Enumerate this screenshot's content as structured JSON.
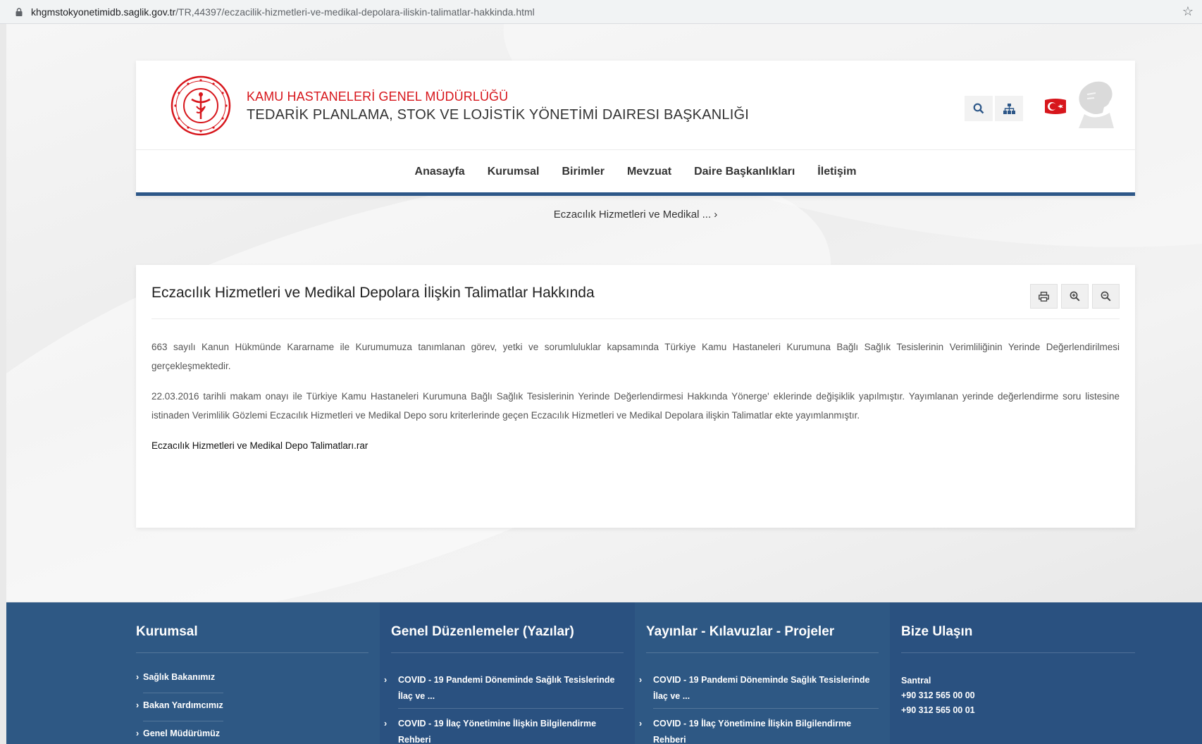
{
  "browser": {
    "url_host": "khgmstokyonetimidb.saglik.gov.tr",
    "url_path": "/TR,44397/eczacilik-hizmetleri-ve-medikal-depolara-iliskin-talimatlar-hakkinda.html"
  },
  "header": {
    "org_line1": "KAMU HASTANELERİ GENEL MÜDÜRLÜĞÜ",
    "org_line2": "TEDARİK PLANLAMA, STOK VE LOJİSTİK YÖNETİMİ DAIRESI BAŞKANLIĞI"
  },
  "nav": {
    "items": [
      "Anasayfa",
      "Kurumsal",
      "Birimler",
      "Mevzuat",
      "Daire Başkanlıkları",
      "İletişim"
    ]
  },
  "breadcrumb": {
    "current": "Eczacılık Hizmetleri ve Medikal ... ›"
  },
  "article": {
    "title": "Eczacılık Hizmetleri ve Medikal Depolara İlişkin Talimatlar Hakkında",
    "paragraph1": "663 sayılı Kanun Hükmünde Kararname ile Kurumumuza tanımlanan görev, yetki ve sorumluluklar kapsamında Türkiye Kamu Hastaneleri Kurumuna Bağlı Sağlık Tesislerinin Verimliliğinin Yerinde Değerlendirilmesi gerçekleşmektedir.",
    "paragraph2": "22.03.2016  tarihli makam onayı ile Türkiye Kamu Hastaneleri Kurumuna Bağlı Sağlık Tesislerinin Yerinde Değerlendirmesi Hakkında Yönerge' eklerinde değişiklik yapılmıştır.  Yayımlanan yerinde değerlendirme soru listesine istinaden Verimlilik Gözlemi Eczacılık Hizmetleri ve Medikal Depo soru kriterlerinde geçen Eczacılık Hizmetleri ve Medikal Depolara ilişkin Talimatlar ekte yayımlanmıştır.",
    "attachment": "Eczacılık Hizmetleri ve Medikal Depo Talimatları.rar"
  },
  "footer": {
    "kurumsal": {
      "heading": "Kurumsal",
      "items": [
        "Sağlık Bakanımız",
        "Bakan Yardımcımız",
        "Genel Müdürümüz"
      ]
    },
    "genel": {
      "heading": "Genel Düzenlemeler (Yazılar)",
      "items": [
        "COVID - 19 Pandemi Döneminde Sağlık Tesislerinde İlaç ve ...",
        "COVID - 19 İlaç Yönetimine İlişkin Bilgilendirme Rehberi"
      ]
    },
    "yayinlar": {
      "heading": "Yayınlar - Kılavuzlar - Projeler",
      "items": [
        "COVID - 19 Pandemi Döneminde Sağlık Tesislerinde İlaç ve ...",
        "COVID - 19 İlaç Yönetimine İlişkin Bilgilendirme Rehberi"
      ]
    },
    "iletisim": {
      "heading": "Bize Ulaşın",
      "santral_label": "Santral",
      "phone1": "+90 312 565 00 00",
      "phone2": "+90 312 565 00 01"
    }
  },
  "colors": {
    "brand_red": "#d7161c",
    "nav_blue": "#2d5788",
    "footer_blue": "#2e5884"
  },
  "icons": [
    "lock-icon",
    "star-icon",
    "search-icon",
    "sitemap-icon",
    "print-icon",
    "zoom-in-icon",
    "zoom-out-icon",
    "chevron-right-icon"
  ]
}
